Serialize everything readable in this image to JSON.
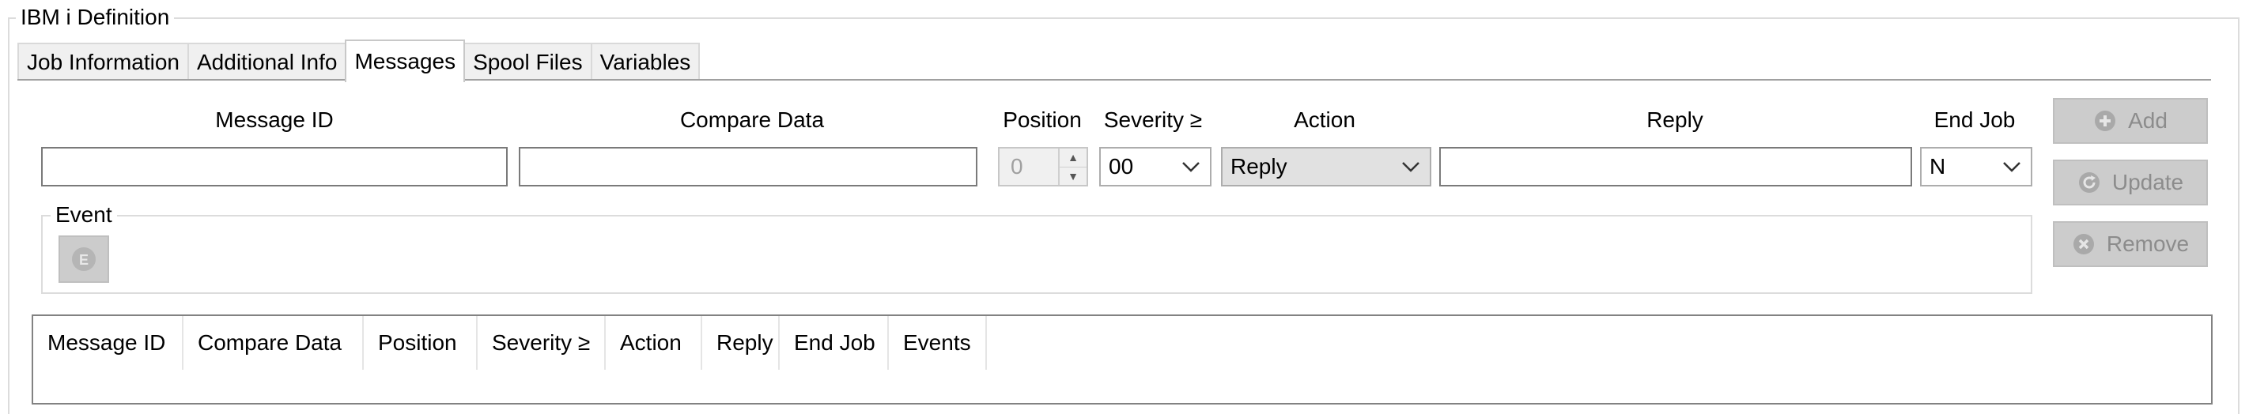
{
  "group": {
    "title": "IBM i Definition"
  },
  "tabs": [
    {
      "label": "Job Information",
      "active": false
    },
    {
      "label": "Additional Info",
      "active": false
    },
    {
      "label": "Messages",
      "active": true
    },
    {
      "label": "Spool Files",
      "active": false
    },
    {
      "label": "Variables",
      "active": false
    }
  ],
  "form": {
    "message_id": {
      "label": "Message ID",
      "value": ""
    },
    "compare_data": {
      "label": "Compare Data",
      "value": ""
    },
    "position": {
      "label": "Position",
      "value": "0"
    },
    "severity": {
      "label": "Severity ≥",
      "value": "00"
    },
    "action": {
      "label": "Action",
      "value": "Reply"
    },
    "reply": {
      "label": "Reply",
      "value": ""
    },
    "end_job": {
      "label": "End Job",
      "value": "N"
    }
  },
  "event_group": {
    "title": "Event",
    "button_icon": "event-icon"
  },
  "buttons": {
    "add": {
      "label": "Add",
      "icon": "plus-circle-icon"
    },
    "update": {
      "label": "Update",
      "icon": "refresh-icon"
    },
    "remove": {
      "label": "Remove",
      "icon": "x-circle-icon"
    }
  },
  "table": {
    "columns": [
      "Message ID",
      "Compare Data",
      "Position",
      "Severity ≥",
      "Action",
      "Reply",
      "End Job",
      "Events"
    ],
    "rows": []
  },
  "colors": {
    "disabled_button_bg": "#cccccc",
    "disabled_text": "#8c8c8c",
    "border": "#7a7a7a"
  }
}
